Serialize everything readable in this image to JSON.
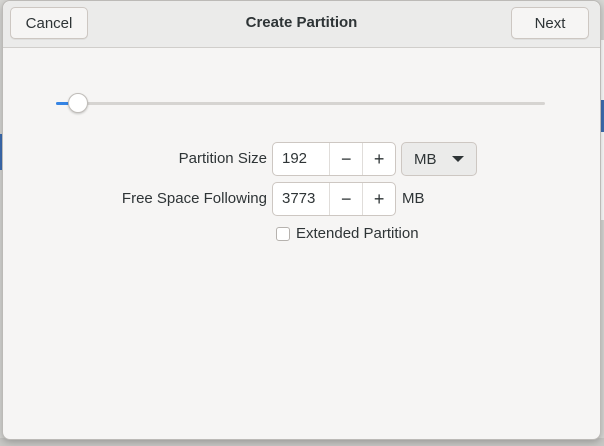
{
  "dialog": {
    "title": "Create Partition",
    "cancel_label": "Cancel",
    "next_label": "Next"
  },
  "slider": {
    "fraction": 0.05
  },
  "form": {
    "partition_size_label": "Partition Size",
    "partition_size_value": "192",
    "partition_size_unit": "MB",
    "free_space_label": "Free Space Following",
    "free_space_value": "3773",
    "free_space_unit": "MB",
    "decrement_glyph": "−",
    "increment_glyph": "+",
    "extended_partition_label": "Extended Partition",
    "extended_partition_checked": false
  },
  "colors": {
    "accent": "#3584e4"
  }
}
